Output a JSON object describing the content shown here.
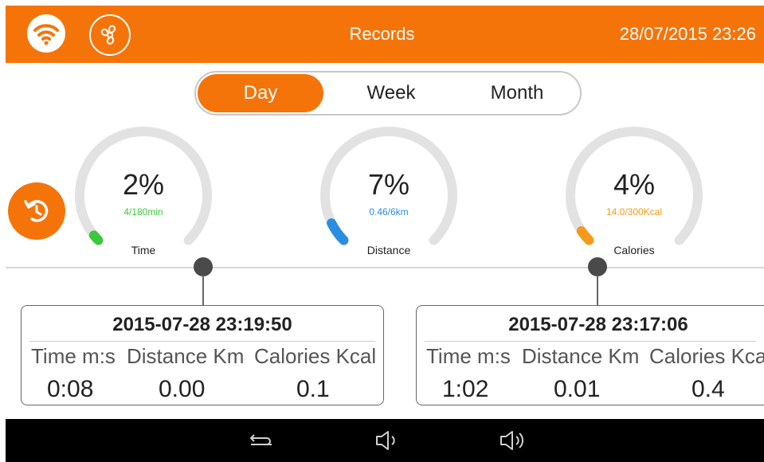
{
  "header": {
    "title": "Records",
    "datetime": "28/07/2015 23:26",
    "accent_color": "#f5740a",
    "icons": [
      "wifi-icon",
      "fan-icon"
    ]
  },
  "tabs": [
    {
      "label": "Day",
      "selected": true
    },
    {
      "label": "Week",
      "selected": false
    },
    {
      "label": "Month",
      "selected": false
    }
  ],
  "reset_button": {
    "icon": "reset-icon"
  },
  "gauges": [
    {
      "percent_label": "2%",
      "progress": 0.02,
      "detail": "4/180min",
      "label": "Time",
      "color": "#3cc83c"
    },
    {
      "percent_label": "7%",
      "progress": 0.07,
      "detail": "0.46/6km",
      "label": "Distance",
      "color": "#2a8de0"
    },
    {
      "percent_label": "4%",
      "progress": 0.04,
      "detail": "14.0/300Kcal",
      "label": "Calories",
      "color": "#f59a1a"
    }
  ],
  "records": [
    {
      "datetime": "2015-07-28 23:19:50",
      "headers": [
        "Time m:s",
        "Distance Km",
        "Calories Kcal"
      ],
      "values": [
        "0:08",
        "0.00",
        "0.1"
      ]
    },
    {
      "datetime": "2015-07-28 23:17:06",
      "headers": [
        "Time m:s",
        "Distance Km",
        "Calories Kcal"
      ],
      "values": [
        "1:02",
        "0.01",
        "0.4"
      ]
    }
  ],
  "navbar": {
    "icons": [
      "back-icon",
      "volume-down-icon",
      "volume-up-icon"
    ]
  }
}
